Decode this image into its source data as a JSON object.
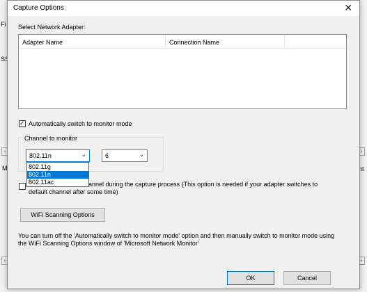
{
  "background_app": {
    "fragments": [
      "Fi",
      "SS",
      "M",
      "ent"
    ]
  },
  "dialog": {
    "title": "Capture Options",
    "select_adapter_label": "Select Network Adapter:",
    "adapter_list": {
      "columns": [
        "Adapter Name",
        "Connection Name"
      ]
    },
    "auto_monitor_checkbox": {
      "label": "Automatically switch to monitor mode",
      "checked": true
    },
    "channel_group": {
      "label": "Channel to monitor",
      "standard_value": "802.11n",
      "channel_value": "6",
      "standard_options": [
        "802.11g",
        "802.11n",
        "802.11ac"
      ],
      "selected_option": "802.11n"
    },
    "switch_channel_checkbox": {
      "label_line1": "annel during the capture process (This option is needed if your adapter switches to",
      "label_line2": "default channel after some time)",
      "checked": false
    },
    "wifi_scan_button": "WiFi Scanning Options",
    "info_text_line1": "You can turn off the 'Automatically switch to monitor mode' option and then manually switch to monitor mode using",
    "info_text_line2": "the WiFi Scanning Options window of 'Microsoft Network Monitor'",
    "ok_button": "OK",
    "cancel_button": "Cancel"
  },
  "colors": {
    "accent": "#0078d7",
    "dialog_bg": "#f0f0f0"
  }
}
